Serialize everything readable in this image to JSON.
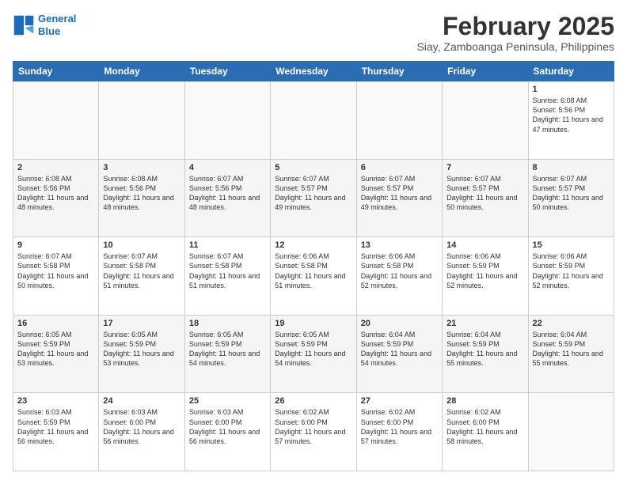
{
  "logo": {
    "line1": "General",
    "line2": "Blue"
  },
  "title": "February 2025",
  "location": "Siay, Zamboanga Peninsula, Philippines",
  "weekdays": [
    "Sunday",
    "Monday",
    "Tuesday",
    "Wednesday",
    "Thursday",
    "Friday",
    "Saturday"
  ],
  "weeks": [
    [
      {
        "day": "",
        "info": ""
      },
      {
        "day": "",
        "info": ""
      },
      {
        "day": "",
        "info": ""
      },
      {
        "day": "",
        "info": ""
      },
      {
        "day": "",
        "info": ""
      },
      {
        "day": "",
        "info": ""
      },
      {
        "day": "1",
        "info": "Sunrise: 6:08 AM\nSunset: 5:56 PM\nDaylight: 11 hours and 47 minutes."
      }
    ],
    [
      {
        "day": "2",
        "info": "Sunrise: 6:08 AM\nSunset: 5:56 PM\nDaylight: 11 hours and 48 minutes."
      },
      {
        "day": "3",
        "info": "Sunrise: 6:08 AM\nSunset: 5:56 PM\nDaylight: 11 hours and 48 minutes."
      },
      {
        "day": "4",
        "info": "Sunrise: 6:07 AM\nSunset: 5:56 PM\nDaylight: 11 hours and 48 minutes."
      },
      {
        "day": "5",
        "info": "Sunrise: 6:07 AM\nSunset: 5:57 PM\nDaylight: 11 hours and 49 minutes."
      },
      {
        "day": "6",
        "info": "Sunrise: 6:07 AM\nSunset: 5:57 PM\nDaylight: 11 hours and 49 minutes."
      },
      {
        "day": "7",
        "info": "Sunrise: 6:07 AM\nSunset: 5:57 PM\nDaylight: 11 hours and 50 minutes."
      },
      {
        "day": "8",
        "info": "Sunrise: 6:07 AM\nSunset: 5:57 PM\nDaylight: 11 hours and 50 minutes."
      }
    ],
    [
      {
        "day": "9",
        "info": "Sunrise: 6:07 AM\nSunset: 5:58 PM\nDaylight: 11 hours and 50 minutes."
      },
      {
        "day": "10",
        "info": "Sunrise: 6:07 AM\nSunset: 5:58 PM\nDaylight: 11 hours and 51 minutes."
      },
      {
        "day": "11",
        "info": "Sunrise: 6:07 AM\nSunset: 5:58 PM\nDaylight: 11 hours and 51 minutes."
      },
      {
        "day": "12",
        "info": "Sunrise: 6:06 AM\nSunset: 5:58 PM\nDaylight: 11 hours and 51 minutes."
      },
      {
        "day": "13",
        "info": "Sunrise: 6:06 AM\nSunset: 5:58 PM\nDaylight: 11 hours and 52 minutes."
      },
      {
        "day": "14",
        "info": "Sunrise: 6:06 AM\nSunset: 5:59 PM\nDaylight: 11 hours and 52 minutes."
      },
      {
        "day": "15",
        "info": "Sunrise: 6:06 AM\nSunset: 5:59 PM\nDaylight: 11 hours and 52 minutes."
      }
    ],
    [
      {
        "day": "16",
        "info": "Sunrise: 6:05 AM\nSunset: 5:59 PM\nDaylight: 11 hours and 53 minutes."
      },
      {
        "day": "17",
        "info": "Sunrise: 6:05 AM\nSunset: 5:59 PM\nDaylight: 11 hours and 53 minutes."
      },
      {
        "day": "18",
        "info": "Sunrise: 6:05 AM\nSunset: 5:59 PM\nDaylight: 11 hours and 54 minutes."
      },
      {
        "day": "19",
        "info": "Sunrise: 6:05 AM\nSunset: 5:59 PM\nDaylight: 11 hours and 54 minutes."
      },
      {
        "day": "20",
        "info": "Sunrise: 6:04 AM\nSunset: 5:59 PM\nDaylight: 11 hours and 54 minutes."
      },
      {
        "day": "21",
        "info": "Sunrise: 6:04 AM\nSunset: 5:59 PM\nDaylight: 11 hours and 55 minutes."
      },
      {
        "day": "22",
        "info": "Sunrise: 6:04 AM\nSunset: 5:59 PM\nDaylight: 11 hours and 55 minutes."
      }
    ],
    [
      {
        "day": "23",
        "info": "Sunrise: 6:03 AM\nSunset: 5:59 PM\nDaylight: 11 hours and 56 minutes."
      },
      {
        "day": "24",
        "info": "Sunrise: 6:03 AM\nSunset: 6:00 PM\nDaylight: 11 hours and 56 minutes."
      },
      {
        "day": "25",
        "info": "Sunrise: 6:03 AM\nSunset: 6:00 PM\nDaylight: 11 hours and 56 minutes."
      },
      {
        "day": "26",
        "info": "Sunrise: 6:02 AM\nSunset: 6:00 PM\nDaylight: 11 hours and 57 minutes."
      },
      {
        "day": "27",
        "info": "Sunrise: 6:02 AM\nSunset: 6:00 PM\nDaylight: 11 hours and 57 minutes."
      },
      {
        "day": "28",
        "info": "Sunrise: 6:02 AM\nSunset: 6:00 PM\nDaylight: 11 hours and 58 minutes."
      },
      {
        "day": "",
        "info": ""
      }
    ]
  ]
}
